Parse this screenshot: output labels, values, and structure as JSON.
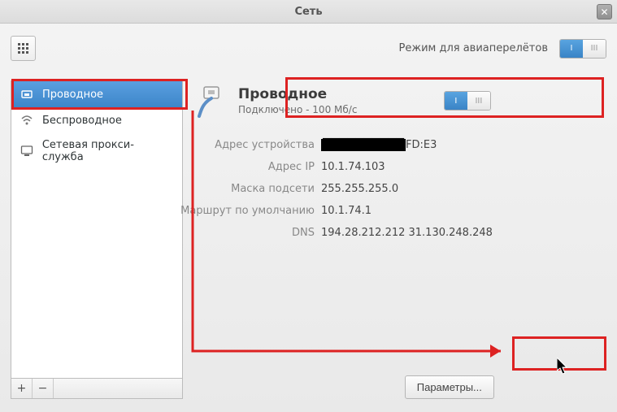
{
  "window_title": "Сеть",
  "airplane_label": "Режим для авиаперелётов",
  "sidebar": {
    "items": [
      {
        "label": "Проводное",
        "icon": "wired"
      },
      {
        "label": "Беспроводное",
        "icon": "wireless"
      },
      {
        "label": "Сетевая прокси-служба",
        "icon": "proxy"
      }
    ]
  },
  "connection": {
    "title": "Проводное",
    "subtitle": "Подключено - 100 Мб/с"
  },
  "info": {
    "hw_label": "Адрес устройства",
    "hw_redacted": "██████████",
    "hw_suffix": "FD:E3",
    "ip_label": "Адрес IP",
    "ip_value": "10.1.74.103",
    "mask_label": "Маска подсети",
    "mask_value": "255.255.255.0",
    "gw_label": "Маршрут по умолчанию",
    "gw_value": "10.1.74.1",
    "dns_label": "DNS",
    "dns_value": "194.28.212.212 31.130.248.248"
  },
  "params_button": "Параметры...",
  "switch_on": "I",
  "switch_off": "III"
}
